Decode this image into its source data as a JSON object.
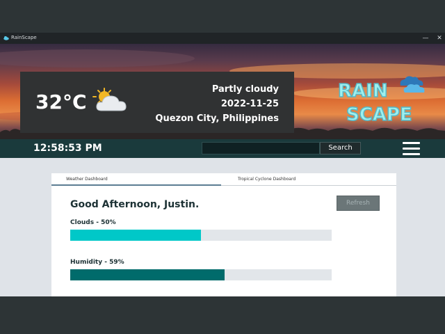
{
  "window": {
    "title": "RainScape",
    "minimize": "—",
    "close": "✕"
  },
  "weather": {
    "temperature": "32°C",
    "condition": "Partly cloudy",
    "date": "2022-11-25",
    "location": "Quezon City, Philippines",
    "icon": "partly-cloudy-icon"
  },
  "logo": {
    "line1": "RAIN",
    "line2": "SCAPE"
  },
  "navbar": {
    "clock": "12:58:53 PM",
    "search_placeholder": "",
    "search_label": "Search",
    "menu_icon": "hamburger-icon"
  },
  "tabs": [
    {
      "label": "Weather Dashboard",
      "active": true
    },
    {
      "label": "Tropical Cyclone Dashboard",
      "active": false
    }
  ],
  "dashboard": {
    "greeting": "Good Afternoon, Justin.",
    "refresh_label": "Refresh",
    "meters": [
      {
        "label": "Clouds - 50%",
        "value": 0.5,
        "color": "#00c8c8"
      },
      {
        "label": "Humidity - 59%",
        "value": 0.59,
        "color": "#006b6b"
      }
    ]
  }
}
